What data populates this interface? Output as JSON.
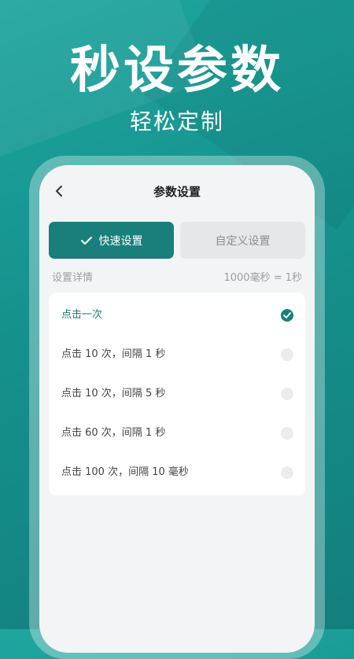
{
  "hero": {
    "title": "秒设参数",
    "subtitle": "轻松定制"
  },
  "nav": {
    "title": "参数设置",
    "back_icon": "chevron-left-icon"
  },
  "tabs": [
    {
      "label": "快速设置",
      "active": true,
      "icon": "check-icon"
    },
    {
      "label": "自定义设置",
      "active": false
    }
  ],
  "details": {
    "label": "设置详情",
    "note": "1000毫秒 = 1秒"
  },
  "options": [
    {
      "label": "点击一次",
      "selected": true
    },
    {
      "label": "点击 10 次，间隔 1 秒",
      "selected": false
    },
    {
      "label": "点击 10 次，间隔 5 秒",
      "selected": false
    },
    {
      "label": "点击 60 次，间隔 1 秒",
      "selected": false
    },
    {
      "label": "点击 100 次，间隔 10  毫秒",
      "selected": false
    }
  ],
  "colors": {
    "accent": "#1a7f7a",
    "background": "#15918c",
    "tab_inactive": "#e6e7e9"
  }
}
